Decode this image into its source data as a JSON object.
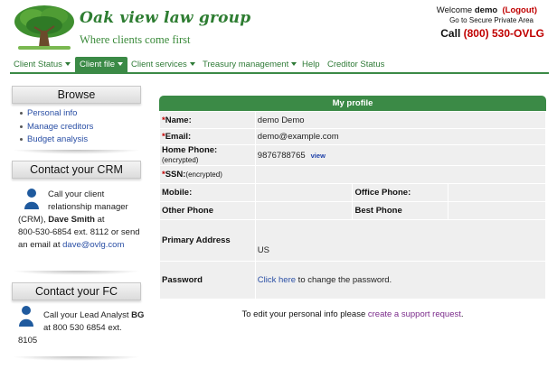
{
  "header": {
    "brand_name": "Oak view law group",
    "tagline": "Where clients come first",
    "welcome_prefix": "Welcome",
    "username": "demo",
    "logout": "(Logout)",
    "secure_link": "Go to Secure Private Area",
    "call_label": "Call",
    "phone": "(800) 530-OVLG"
  },
  "nav": {
    "items": [
      {
        "label": "Client Status"
      },
      {
        "label": "Client file"
      },
      {
        "label": "Client services"
      },
      {
        "label": "Treasury management"
      },
      {
        "label": "Help"
      },
      {
        "label": "Creditor Status"
      }
    ]
  },
  "sidebar": {
    "browse_title": "Browse",
    "browse_links": [
      "Personal info",
      "Manage creditors",
      "Budget analysis"
    ],
    "crm_title": "Contact your CRM",
    "crm_line1": "Call your client",
    "crm_line2": "relationship manager",
    "crm_line3_prefix": "(CRM), ",
    "crm_name": "Dave Smith",
    "crm_line3_suffix": " at",
    "crm_line4": "800-530-6854 ext. 8112 or send",
    "crm_line5_prefix": "an email at ",
    "crm_email": "dave@ovlg.com",
    "fc_title": "Contact your FC",
    "fc_line1_prefix": "Call your Lead Analyst ",
    "fc_name": "BG",
    "fc_line2": "at 800 530 6854 ext.",
    "fc_line3": "8105"
  },
  "profile": {
    "title": "My profile",
    "name_label": "Name:",
    "name_value": "demo Demo",
    "email_label": "Email:",
    "email_value": "demo@example.com",
    "home_phone_label": "Home Phone:",
    "encrypted": "(encrypted)",
    "home_phone_value": "9876788765",
    "view_link": "view",
    "ssn_label": "SSN:",
    "mobile_label": "Mobile:",
    "office_phone_label": "Office Phone:",
    "other_phone_label": "Other Phone",
    "best_phone_label": "Best Phone",
    "address_label": "Primary Address",
    "address_value": "US",
    "password_label": "Password",
    "password_link": "Click here",
    "password_suffix": " to change the password.",
    "required_mark": "*"
  },
  "footer_note": {
    "prefix": "To edit your personal info please ",
    "link": "create a support request",
    "suffix": "."
  },
  "colors": {
    "brand_green": "#3b8a46",
    "phone_red": "#c00000",
    "link_blue": "#2a4fa5"
  }
}
